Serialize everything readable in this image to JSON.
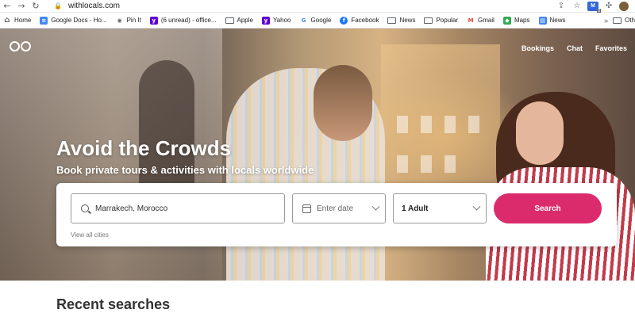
{
  "browser": {
    "url": "withlocals.com",
    "bookmarks": [
      {
        "label": "Home",
        "icon": "home-icon"
      },
      {
        "label": "Google Docs - Ho...",
        "icon": "google-docs-icon"
      },
      {
        "label": "Pin It",
        "icon": "pinterest-icon"
      },
      {
        "label": "(6 unread) - office...",
        "icon": "yahoo-mail-icon"
      },
      {
        "label": "Apple",
        "icon": "folder-icon"
      },
      {
        "label": "Yahoo",
        "icon": "yahoo-icon"
      },
      {
        "label": "Google",
        "icon": "google-icon"
      },
      {
        "label": "Facebook",
        "icon": "facebook-icon"
      },
      {
        "label": "News",
        "icon": "folder-icon"
      },
      {
        "label": "Popular",
        "icon": "folder-icon"
      },
      {
        "label": "Gmail",
        "icon": "gmail-icon"
      },
      {
        "label": "Maps",
        "icon": "maps-icon"
      },
      {
        "label": "News",
        "icon": "news-icon"
      }
    ],
    "overflow": "»",
    "other": "Oth",
    "ext_badge": "2"
  },
  "site": {
    "nav": {
      "bookings": "Bookings",
      "chat": "Chat",
      "favorites": "Favorites"
    },
    "headline": "Avoid the Crowds",
    "subheadline": "Book private tours & activities with locals worldwide",
    "search": {
      "city_value": "Marrakech, Morocco",
      "date_placeholder": "Enter date",
      "guests_value": "1 Adult",
      "button_label": "Search",
      "view_all": "View all cities"
    },
    "recent_heading": "Recent searches"
  },
  "colors": {
    "accent": "#dc2b6d"
  }
}
